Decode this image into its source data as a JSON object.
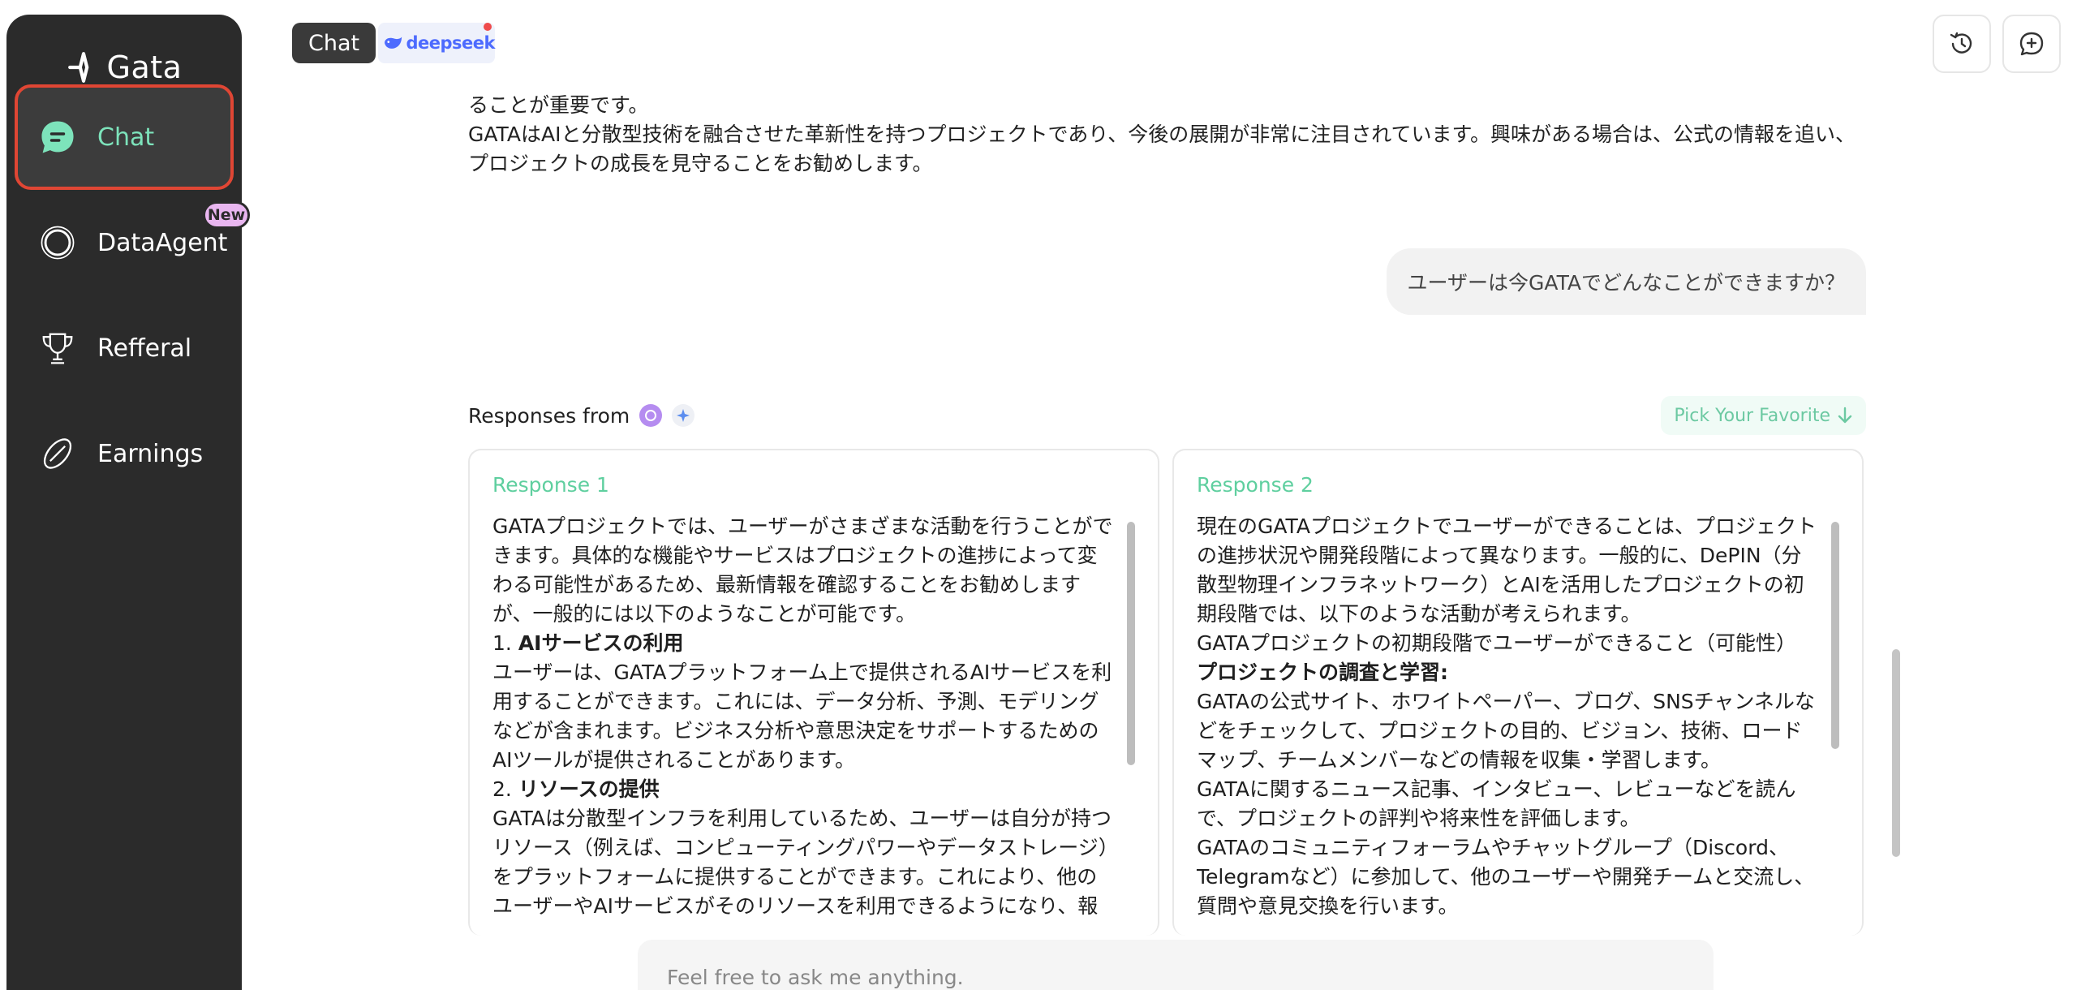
{
  "app": {
    "logo_text": "Gata"
  },
  "sidebar": {
    "items": [
      {
        "label": "Chat",
        "icon": "chat-bubble-icon",
        "active": true
      },
      {
        "label": "DataAgent",
        "icon": "orb-icon",
        "badge": "New"
      },
      {
        "label": "Refferal",
        "icon": "trophy-icon"
      },
      {
        "label": "Earnings",
        "icon": "coin-icon"
      }
    ]
  },
  "topbar": {
    "chat_chip": "Chat",
    "model_name": "deepseek",
    "history_icon": "history-icon",
    "new_chat_icon": "new-chat-icon"
  },
  "conversation": {
    "previous_answer_tail": [
      "ることが重要です。",
      "GATAはAIと分散型技術を融合させた革新性を持つプロジェクトであり、今後の展開が非常に注目されています。興味がある場合は、公式の情報を追い、プロジェクトの成長を見守ることをお勧めします。"
    ],
    "user_message": "ユーザーは今GATAでどんなことができますか？",
    "responses_from_label": "Responses from",
    "pick_favorite_label": "Pick Your Favorite",
    "responses": [
      {
        "title": "Response 1",
        "paragraphs": [
          "GATAプロジェクトでは、ユーザーがさまざまな活動を行うことができます。具体的な機能やサービスはプロジェクトの進捗によって変わる可能性があるため、最新情報を確認することをお勧めしますが、一般的には以下のようなことが可能です。",
          "1. ",
          "AIサービスの利用",
          "ユーザーは、GATAプラットフォーム上で提供されるAIサービスを利用することができます。これには、データ分析、予測、モデリングなどが含まれます。ビジネス分析や意思決定をサポートするためのAIツールが提供されることがあります。",
          "2. ",
          "リソースの提供",
          "GATAは分散型インフラを利用しているため、ユーザーは自分が持つリソース（例えば、コンピューティングパワーやデータストレージ）をプラットフォームに提供することができます。これにより、他のユーザーやAIサービスがそのリソースを利用できるようになり、報"
        ]
      },
      {
        "title": "Response 2",
        "paragraphs": [
          "現在のGATAプロジェクトでユーザーができることは、プロジェクトの進捗状況や開発段階によって異なります。一般的に、DePIN（分散型物理インフラネットワーク）とAIを活用したプロジェクトの初期段階では、以下のような活動が考えられます。",
          "GATAプロジェクトの初期段階でユーザーができること（可能性）",
          "プロジェクトの調査と学習:",
          "GATAの公式サイト、ホワイトペーパー、ブログ、SNSチャンネルなどをチェックして、プロジェクトの目的、ビジョン、技術、ロードマップ、チームメンバーなどの情報を収集・学習します。",
          "GATAに関するニュース記事、インタビュー、レビューなどを読んで、プロジェクトの評判や将来性を評価します。",
          "GATAのコミュニティフォーラムやチャットグループ（Discord、Telegramなど）に参加して、他のユーザーや開発チームと交流し、質問や意見交換を行います。"
        ]
      }
    ]
  },
  "composer": {
    "placeholder": "Feel free to ask me anything."
  },
  "colors": {
    "accent": "#5fcf9f",
    "sidebar_bg": "#2b2b2b",
    "active_border": "#e04634",
    "badge": "#e9b6f0"
  }
}
